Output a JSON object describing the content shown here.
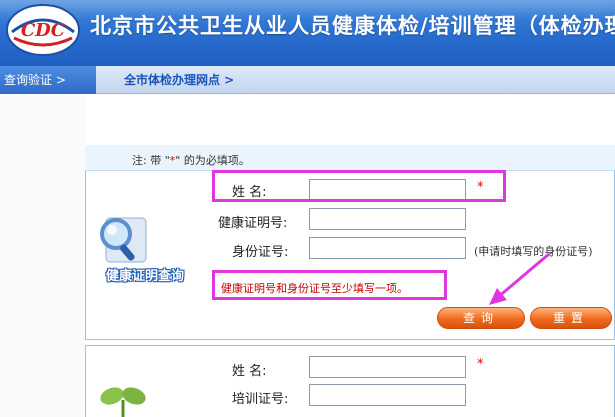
{
  "header": {
    "title": "北京市公共卫生从业人员健康体检/培训管理（体检办理"
  },
  "nav": {
    "items": [
      {
        "label": "查询验证 >"
      },
      {
        "label": "全市体检办理网点 >"
      }
    ]
  },
  "form": {
    "note_prefix": "注: 带 \"",
    "note_star": "*",
    "note_suffix": "\" 的为必填项。",
    "name_label": "姓      名:",
    "required_mark": "*",
    "cert_label": "健康证明号:",
    "id_label": "身份证号:",
    "id_hint": "(申请时填写的身份证号)",
    "warning": "健康证明号和身份证号至少填写一项。",
    "search_button": "查询",
    "reset_button": "重置",
    "badge_text": "健康证明查询"
  },
  "form2": {
    "name_label": "姓      名:",
    "required_mark": "*",
    "training_label": "培训证号:"
  }
}
